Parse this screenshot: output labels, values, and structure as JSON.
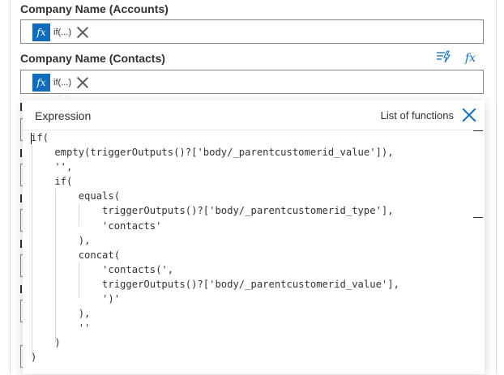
{
  "fields": [
    {
      "label": "Company Name (Accounts)",
      "token_icon": "fx",
      "token_text": "if(...)"
    },
    {
      "label": "Company Name (Contacts)",
      "token_icon": "fx",
      "token_text": "if(...)"
    }
  ],
  "label_actions": {
    "dynamic_content_icon": "dynamic-content-icon",
    "expression_icon": "fx"
  },
  "expression_panel": {
    "title": "Expression",
    "functions_link": "List of functions",
    "close_icon": "close-icon",
    "code_lines": [
      "if(",
      "    empty(triggerOutputs()?['body/_parentcustomerid_value']),",
      "    '',",
      "    if(",
      "        equals(",
      "            triggerOutputs()?['body/_parentcustomerid_type'],",
      "            'contacts'",
      "        ),",
      "        concat(",
      "            'contacts(',",
      "            triggerOutputs()?['body/_parentcustomerid_value'],",
      "            ')'",
      "        ),",
      "        ''",
      "    )",
      ")"
    ]
  },
  "colors": {
    "accent": "#0f6cbd",
    "border": "#8a8886",
    "text": "#323130"
  }
}
